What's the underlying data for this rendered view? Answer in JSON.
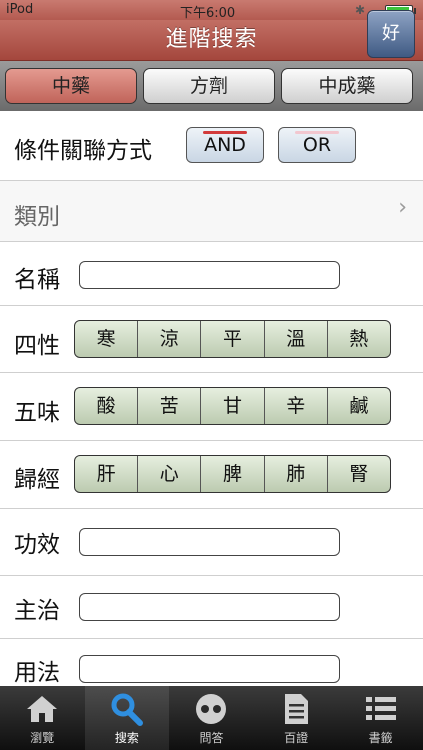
{
  "status": {
    "carrier": "iPod",
    "time": "下午6:00"
  },
  "nav": {
    "title": "進階搜索",
    "fav_button": "好"
  },
  "segments": [
    {
      "label": "中藥",
      "active": true
    },
    {
      "label": "方劑",
      "active": false
    },
    {
      "label": "中成藥",
      "active": false
    }
  ],
  "condition": {
    "label": "條件關聯方式",
    "and_label": "AND",
    "or_label": "OR",
    "selected": "AND"
  },
  "category": {
    "label": "類別"
  },
  "name_field": {
    "label": "名稱",
    "value": ""
  },
  "four_natures": {
    "label": "四性",
    "options": [
      "寒",
      "涼",
      "平",
      "溫",
      "熱"
    ]
  },
  "five_flavors": {
    "label": "五味",
    "options": [
      "酸",
      "苦",
      "甘",
      "辛",
      "鹹"
    ]
  },
  "meridians": {
    "label": "歸經",
    "options": [
      "肝",
      "心",
      "脾",
      "肺",
      "腎"
    ]
  },
  "efficacy_field": {
    "label": "功效",
    "value": ""
  },
  "indication_field": {
    "label": "主治",
    "value": ""
  },
  "usage_field": {
    "label": "用法",
    "value": ""
  },
  "tabs": [
    {
      "label": "瀏覽",
      "icon": "home-icon",
      "active": false
    },
    {
      "label": "搜索",
      "icon": "search-icon",
      "active": true
    },
    {
      "label": "問答",
      "icon": "qa-icon",
      "active": false
    },
    {
      "label": "百證",
      "icon": "document-icon",
      "active": false
    },
    {
      "label": "書籤",
      "icon": "list-icon",
      "active": false
    }
  ],
  "colors": {
    "nav": "#b5584d",
    "tabbar": "#1a1a1a",
    "choice": "#d4e0cb"
  }
}
